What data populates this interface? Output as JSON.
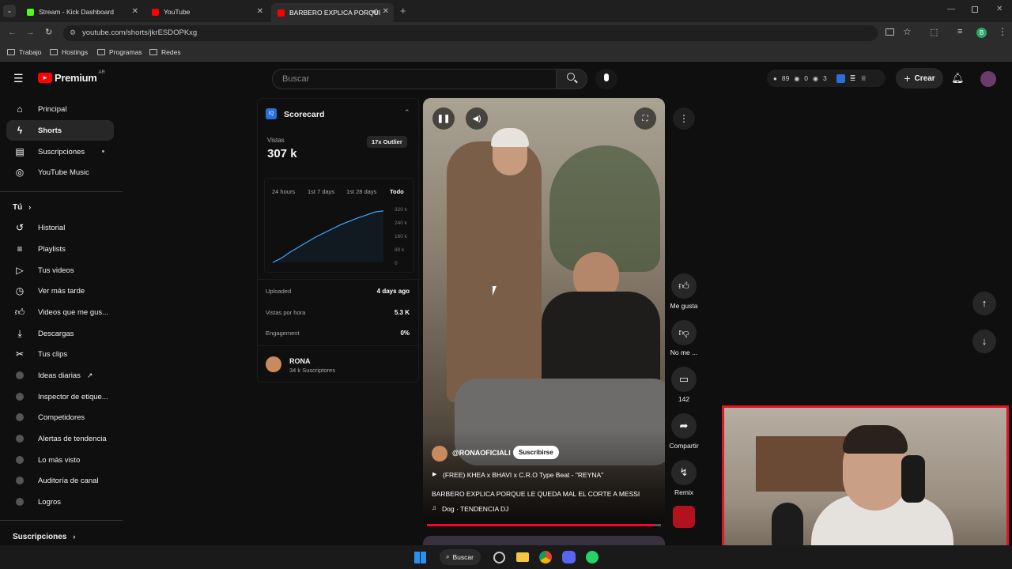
{
  "browser": {
    "tabs": [
      {
        "label": "Stream - Kick Dashboard",
        "fav_color": "#53fc18"
      },
      {
        "label": "YouTube",
        "fav_color": "#ff0000"
      },
      {
        "label": "BARBERO EXPLICA PORQUI",
        "fav_color": "#ff0000"
      }
    ],
    "url": "youtube.com/shorts/jkrESDOPKxg",
    "bookmarks": [
      "Trabajo",
      "Hostings",
      "Programas",
      "Redes"
    ],
    "profile_initial": "B"
  },
  "header": {
    "logo": "Premium",
    "region": "AR",
    "search_placeholder": "Buscar",
    "stats": {
      "a": "89",
      "b": "0",
      "c": "3"
    },
    "create_label": "Crear"
  },
  "sidebar": {
    "main": [
      {
        "label": "Principal",
        "icon": "home-icon"
      },
      {
        "label": "Shorts",
        "icon": "shorts-icon"
      },
      {
        "label": "Suscripciones",
        "icon": "subscriptions-icon"
      },
      {
        "label": "YouTube Music",
        "icon": "music-icon"
      }
    ],
    "you_title": "Tú",
    "you": [
      {
        "label": "Historial",
        "icon": "history-icon"
      },
      {
        "label": "Playlists",
        "icon": "playlist-icon"
      },
      {
        "label": "Tus videos",
        "icon": "video-icon"
      },
      {
        "label": "Ver más tarde",
        "icon": "clock-icon"
      },
      {
        "label": "Videos que me gus...",
        "icon": "like-icon"
      },
      {
        "label": "Descargas",
        "icon": "download-icon"
      },
      {
        "label": "Tus clips",
        "icon": "scissors-icon"
      }
    ],
    "tools": [
      {
        "label": "Ideas diarias"
      },
      {
        "label": "Inspector de etique..."
      },
      {
        "label": "Competidores"
      },
      {
        "label": "Alertas de tendencia"
      },
      {
        "label": "Lo más visto"
      },
      {
        "label": "Auditoría de canal"
      },
      {
        "label": "Logros"
      }
    ],
    "subs_title": "Suscripciones"
  },
  "scorecard": {
    "title": "Scorecard",
    "views_label": "Vistas",
    "views_value": "307 k",
    "outlier": "17x Outlier",
    "ranges": [
      "24 hours",
      "1st 7 days",
      "1st 28 days",
      "Todo"
    ],
    "active_range": "Todo",
    "rows": [
      {
        "label": "Uploaded",
        "value": "4 days ago"
      },
      {
        "label": "Vistas por hora",
        "value": "5.3 K"
      },
      {
        "label": "Engagement",
        "value": "0%"
      }
    ],
    "channel_name": "RONA",
    "channel_subs": "34 k Suscriptores"
  },
  "chart_data": {
    "type": "area",
    "title": "",
    "xlabel": "",
    "ylabel": "",
    "yticks": [
      "320 k",
      "240 k",
      "160 k",
      "80 k",
      "0"
    ],
    "ylim": [
      0,
      320000
    ],
    "values": [
      0,
      25000,
      60000,
      90000,
      120000,
      150000,
      175000,
      200000,
      225000,
      245000,
      265000,
      282000,
      300000,
      307000
    ],
    "color": "#3ea6ff"
  },
  "video": {
    "channel": "@RONAOFICIALI",
    "subscribe_label": "Suscribirse",
    "music_title": "(FREE) KHEA x BHAVI x C.R.O Type Beat - \"REYNA\"",
    "title": "BARBERO EXPLICA PORQUE LE QUEDA MAL EL CORTE A MESSI",
    "sound": "Dog · TENDENCIA DJ",
    "progress": 0.97
  },
  "actions": {
    "like": "Me gusta",
    "dislike": "No me ...",
    "comments": "142",
    "share": "Compartir",
    "remix": "Remix"
  },
  "taskbar": {
    "search_label": "Buscar"
  }
}
